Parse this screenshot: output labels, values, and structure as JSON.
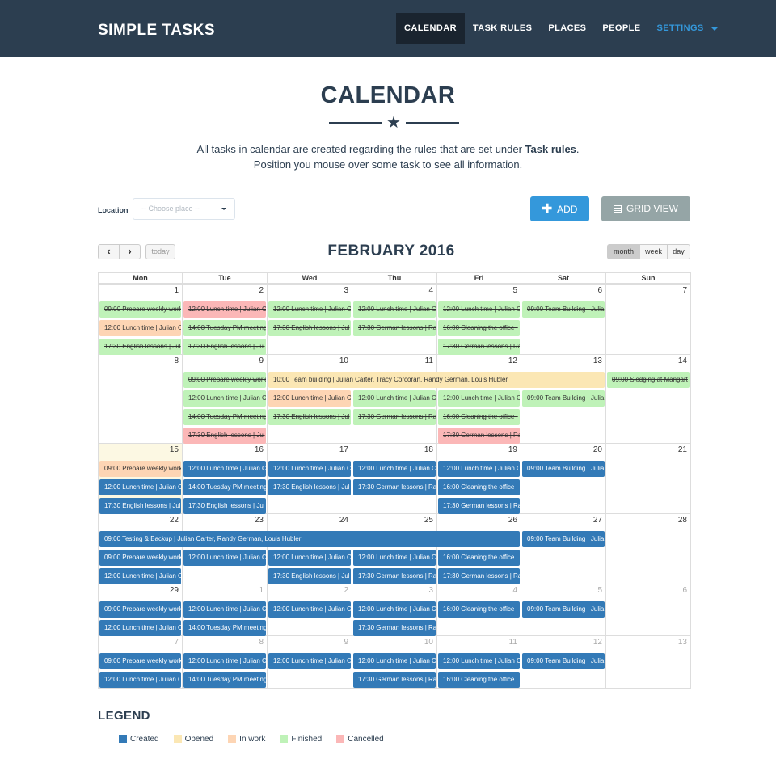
{
  "app": {
    "brand": "SIMPLE TASKS"
  },
  "nav": {
    "items": [
      {
        "label": "CALENDAR",
        "active": true
      },
      {
        "label": "TASK RULES",
        "active": false
      },
      {
        "label": "PLACES",
        "active": false
      },
      {
        "label": "PEOPLE",
        "active": false
      }
    ],
    "settings_label": "SETTINGS"
  },
  "header": {
    "title": "CALENDAR",
    "intro_line1_prefix": "All tasks in calendar are created regarding the rules that are set under ",
    "intro_line1_link": "Task rules",
    "intro_line1_suffix": ".",
    "intro_line2": "Position you mouse over some task to see all information."
  },
  "toolbar": {
    "location_label": "Location",
    "location_placeholder": "-- Choose place --",
    "add_label": "ADD",
    "grid_view_label": "GRID VIEW"
  },
  "calendar": {
    "title": "FEBRUARY 2016",
    "prev_icon": "‹",
    "next_icon": "›",
    "today_label": "today",
    "views": [
      "month",
      "week",
      "day"
    ],
    "active_view": "month",
    "weekdays": [
      "Mon",
      "Tue",
      "Wed",
      "Thu",
      "Fri",
      "Sat",
      "Sun"
    ],
    "today_date": {
      "week": 2,
      "day": 0
    },
    "weeks": [
      {
        "dates": [
          "1",
          "2",
          "3",
          "4",
          "5",
          "6",
          "7"
        ]
      },
      {
        "dates": [
          "8",
          "9",
          "10",
          "11",
          "12",
          "13",
          "14"
        ]
      },
      {
        "dates": [
          "15",
          "16",
          "17",
          "18",
          "19",
          "20",
          "21"
        ]
      },
      {
        "dates": [
          "22",
          "23",
          "24",
          "25",
          "26",
          "27",
          "28"
        ]
      },
      {
        "dates": [
          "29",
          "1",
          "2",
          "3",
          "4",
          "5",
          "6"
        ]
      },
      {
        "dates": [
          "7",
          "8",
          "9",
          "10",
          "11",
          "12",
          "13"
        ]
      }
    ],
    "events": [
      {
        "week": 0,
        "day": 0,
        "span": 1,
        "slot": 0,
        "status": "finished",
        "text": "09:00 Prepare weekly work"
      },
      {
        "week": 0,
        "day": 0,
        "span": 1,
        "slot": 1,
        "status": "inwork",
        "text": "12:00 Lunch time | Julian C"
      },
      {
        "week": 0,
        "day": 0,
        "span": 1,
        "slot": 2,
        "status": "finished",
        "text": "17:30 English lessons | Jul"
      },
      {
        "week": 0,
        "day": 1,
        "span": 1,
        "slot": 0,
        "status": "cancelled",
        "text": "12:00 Lunch time | Julian C"
      },
      {
        "week": 0,
        "day": 1,
        "span": 1,
        "slot": 1,
        "status": "finished",
        "text": "14:00 Tuesday PM meeting"
      },
      {
        "week": 0,
        "day": 1,
        "span": 1,
        "slot": 2,
        "status": "finished",
        "text": "17:30 English lessons | Jul"
      },
      {
        "week": 0,
        "day": 2,
        "span": 1,
        "slot": 0,
        "status": "finished",
        "text": "12:00 Lunch time | Julian C"
      },
      {
        "week": 0,
        "day": 2,
        "span": 1,
        "slot": 1,
        "status": "finished",
        "text": "17:30 English lessons | Jul"
      },
      {
        "week": 0,
        "day": 3,
        "span": 1,
        "slot": 0,
        "status": "finished",
        "text": "12:00 Lunch time | Julian C"
      },
      {
        "week": 0,
        "day": 3,
        "span": 1,
        "slot": 1,
        "status": "finished",
        "text": "17:30 German lessons | Ra"
      },
      {
        "week": 0,
        "day": 4,
        "span": 1,
        "slot": 0,
        "status": "finished",
        "text": "12:00 Lunch time | Julian C"
      },
      {
        "week": 0,
        "day": 4,
        "span": 1,
        "slot": 1,
        "status": "finished",
        "text": "16:00 Cleaning the office |"
      },
      {
        "week": 0,
        "day": 4,
        "span": 1,
        "slot": 2,
        "status": "finished",
        "text": "17:30 German lessons | Ra"
      },
      {
        "week": 0,
        "day": 5,
        "span": 1,
        "slot": 0,
        "status": "finished",
        "text": "09:00 Team Building | Julia"
      },
      {
        "week": 1,
        "day": 1,
        "span": 1,
        "slot": 0,
        "status": "finished",
        "text": "09:00 Prepare weekly work"
      },
      {
        "week": 1,
        "day": 2,
        "span": 4,
        "slot": 0,
        "status": "opened",
        "text": "10:00 Team building | Julian Carter, Tracy Corcoran, Randy German, Louis Hubler"
      },
      {
        "week": 1,
        "day": 6,
        "span": 1,
        "slot": 0,
        "status": "finished",
        "text": "09:00 Sledging at Mangart"
      },
      {
        "week": 1,
        "day": 1,
        "span": 1,
        "slot": 1,
        "status": "finished",
        "text": "12:00 Lunch time | Julian C"
      },
      {
        "week": 1,
        "day": 1,
        "span": 1,
        "slot": 2,
        "status": "finished",
        "text": "14:00 Tuesday PM meeting"
      },
      {
        "week": 1,
        "day": 1,
        "span": 1,
        "slot": 3,
        "status": "cancelled",
        "text": "17:30 English lessons | Jul"
      },
      {
        "week": 1,
        "day": 2,
        "span": 1,
        "slot": 1,
        "status": "inwork",
        "text": "12:00 Lunch time | Julian C"
      },
      {
        "week": 1,
        "day": 2,
        "span": 1,
        "slot": 2,
        "status": "finished",
        "text": "17:30 English lessons | Jul"
      },
      {
        "week": 1,
        "day": 3,
        "span": 1,
        "slot": 1,
        "status": "finished",
        "text": "12:00 Lunch time | Julian C"
      },
      {
        "week": 1,
        "day": 3,
        "span": 1,
        "slot": 2,
        "status": "finished",
        "text": "17:30 German lessons | Ra"
      },
      {
        "week": 1,
        "day": 4,
        "span": 1,
        "slot": 1,
        "status": "finished",
        "text": "12:00 Lunch time | Julian C"
      },
      {
        "week": 1,
        "day": 4,
        "span": 1,
        "slot": 2,
        "status": "finished",
        "text": "16:00 Cleaning the office |"
      },
      {
        "week": 1,
        "day": 4,
        "span": 1,
        "slot": 3,
        "status": "cancelled",
        "text": "17:30 German lessons | Ra"
      },
      {
        "week": 1,
        "day": 5,
        "span": 1,
        "slot": 1,
        "status": "finished",
        "text": "09:00 Team Building | Julia"
      },
      {
        "week": 2,
        "day": 0,
        "span": 1,
        "slot": 0,
        "status": "inwork",
        "text": "09:00 Prepare weekly work"
      },
      {
        "week": 2,
        "day": 0,
        "span": 1,
        "slot": 1,
        "status": "created",
        "text": "12:00 Lunch time | Julian C"
      },
      {
        "week": 2,
        "day": 0,
        "span": 1,
        "slot": 2,
        "status": "created",
        "text": "17:30 English lessons | Jul"
      },
      {
        "week": 2,
        "day": 1,
        "span": 1,
        "slot": 0,
        "status": "created",
        "text": "12:00 Lunch time | Julian C"
      },
      {
        "week": 2,
        "day": 1,
        "span": 1,
        "slot": 1,
        "status": "created",
        "text": "14:00 Tuesday PM meeting"
      },
      {
        "week": 2,
        "day": 1,
        "span": 1,
        "slot": 2,
        "status": "created",
        "text": "17:30 English lessons | Jul"
      },
      {
        "week": 2,
        "day": 2,
        "span": 1,
        "slot": 0,
        "status": "created",
        "text": "12:00 Lunch time | Julian C"
      },
      {
        "week": 2,
        "day": 2,
        "span": 1,
        "slot": 1,
        "status": "created",
        "text": "17:30 English lessons | Jul"
      },
      {
        "week": 2,
        "day": 3,
        "span": 1,
        "slot": 0,
        "status": "created",
        "text": "12:00 Lunch time | Julian C"
      },
      {
        "week": 2,
        "day": 3,
        "span": 1,
        "slot": 1,
        "status": "created",
        "text": "17:30 German lessons | Ra"
      },
      {
        "week": 2,
        "day": 4,
        "span": 1,
        "slot": 0,
        "status": "created",
        "text": "12:00 Lunch time | Julian C"
      },
      {
        "week": 2,
        "day": 4,
        "span": 1,
        "slot": 1,
        "status": "created",
        "text": "16:00 Cleaning the office |"
      },
      {
        "week": 2,
        "day": 4,
        "span": 1,
        "slot": 2,
        "status": "created",
        "text": "17:30 German lessons | Ra"
      },
      {
        "week": 2,
        "day": 5,
        "span": 1,
        "slot": 0,
        "status": "created",
        "text": "09:00 Team Building | Julia"
      },
      {
        "week": 3,
        "day": 0,
        "span": 5,
        "slot": 0,
        "status": "created",
        "text": "09:00 Testing & Backup | Julian Carter, Randy German, Louis Hubler"
      },
      {
        "week": 3,
        "day": 5,
        "span": 1,
        "slot": 0,
        "status": "created",
        "text": "09:00 Team Building | Julia"
      },
      {
        "week": 3,
        "day": 0,
        "span": 1,
        "slot": 1,
        "status": "created",
        "text": "09:00 Prepare weekly work"
      },
      {
        "week": 3,
        "day": 0,
        "span": 1,
        "slot": 2,
        "status": "created",
        "text": "12:00 Lunch time | Julian C"
      },
      {
        "week": 3,
        "day": 1,
        "span": 1,
        "slot": 1,
        "status": "created",
        "text": "12:00 Lunch time | Julian C"
      },
      {
        "week": 3,
        "day": 2,
        "span": 1,
        "slot": 1,
        "status": "created",
        "text": "12:00 Lunch time | Julian C"
      },
      {
        "week": 3,
        "day": 2,
        "span": 1,
        "slot": 2,
        "status": "created",
        "text": "17:30 English lessons | Jul"
      },
      {
        "week": 3,
        "day": 3,
        "span": 1,
        "slot": 1,
        "status": "created",
        "text": "12:00 Lunch time | Julian C"
      },
      {
        "week": 3,
        "day": 3,
        "span": 1,
        "slot": 2,
        "status": "created",
        "text": "17:30 German lessons | Ra"
      },
      {
        "week": 3,
        "day": 4,
        "span": 1,
        "slot": 1,
        "status": "created",
        "text": "16:00 Cleaning the office |"
      },
      {
        "week": 3,
        "day": 4,
        "span": 1,
        "slot": 2,
        "status": "created",
        "text": "17:30 German lessons | Ra"
      },
      {
        "week": 4,
        "day": 0,
        "span": 1,
        "slot": 0,
        "status": "created",
        "text": "09:00 Prepare weekly work"
      },
      {
        "week": 4,
        "day": 0,
        "span": 1,
        "slot": 1,
        "status": "created",
        "text": "12:00 Lunch time | Julian C"
      },
      {
        "week": 4,
        "day": 1,
        "span": 1,
        "slot": 0,
        "status": "created",
        "text": "12:00 Lunch time | Julian C"
      },
      {
        "week": 4,
        "day": 1,
        "span": 1,
        "slot": 1,
        "status": "created",
        "text": "14:00 Tuesday PM meeting"
      },
      {
        "week": 4,
        "day": 2,
        "span": 1,
        "slot": 0,
        "status": "created",
        "text": "12:00 Lunch time | Julian C"
      },
      {
        "week": 4,
        "day": 3,
        "span": 1,
        "slot": 0,
        "status": "created",
        "text": "12:00 Lunch time | Julian C"
      },
      {
        "week": 4,
        "day": 3,
        "span": 1,
        "slot": 1,
        "status": "created",
        "text": "17:30 German lessons | Ra"
      },
      {
        "week": 4,
        "day": 4,
        "span": 1,
        "slot": 0,
        "status": "created",
        "text": "16:00 Cleaning the office |"
      },
      {
        "week": 4,
        "day": 5,
        "span": 1,
        "slot": 0,
        "status": "created",
        "text": "09:00 Team Building | Julia"
      },
      {
        "week": 5,
        "day": 0,
        "span": 1,
        "slot": 0,
        "status": "created",
        "text": "09:00 Prepare weekly work"
      },
      {
        "week": 5,
        "day": 0,
        "span": 1,
        "slot": 1,
        "status": "created",
        "text": "12:00 Lunch time | Julian C"
      },
      {
        "week": 5,
        "day": 1,
        "span": 1,
        "slot": 0,
        "status": "created",
        "text": "12:00 Lunch time | Julian C"
      },
      {
        "week": 5,
        "day": 1,
        "span": 1,
        "slot": 1,
        "status": "created",
        "text": "14:00 Tuesday PM meeting"
      },
      {
        "week": 5,
        "day": 2,
        "span": 1,
        "slot": 0,
        "status": "created",
        "text": "12:00 Lunch time | Julian C"
      },
      {
        "week": 5,
        "day": 3,
        "span": 1,
        "slot": 0,
        "status": "created",
        "text": "12:00 Lunch time | Julian C"
      },
      {
        "week": 5,
        "day": 3,
        "span": 1,
        "slot": 1,
        "status": "created",
        "text": "17:30 German lessons | Ra"
      },
      {
        "week": 5,
        "day": 4,
        "span": 1,
        "slot": 0,
        "status": "created",
        "text": "12:00 Lunch time | Julian C"
      },
      {
        "week": 5,
        "day": 4,
        "span": 1,
        "slot": 1,
        "status": "created",
        "text": "16:00 Cleaning the office |"
      },
      {
        "week": 5,
        "day": 5,
        "span": 1,
        "slot": 0,
        "status": "created",
        "text": "09:00 Team Building | Julia"
      }
    ]
  },
  "legend": {
    "title": "LEGEND",
    "items": [
      {
        "label": "Created",
        "color": "#337ab7"
      },
      {
        "label": "Opened",
        "color": "#fbe7b4"
      },
      {
        "label": "In work",
        "color": "#fdd5b4"
      },
      {
        "label": "Finished",
        "color": "#bff2b8"
      },
      {
        "label": "Cancelled",
        "color": "#fbb7b7"
      }
    ]
  }
}
